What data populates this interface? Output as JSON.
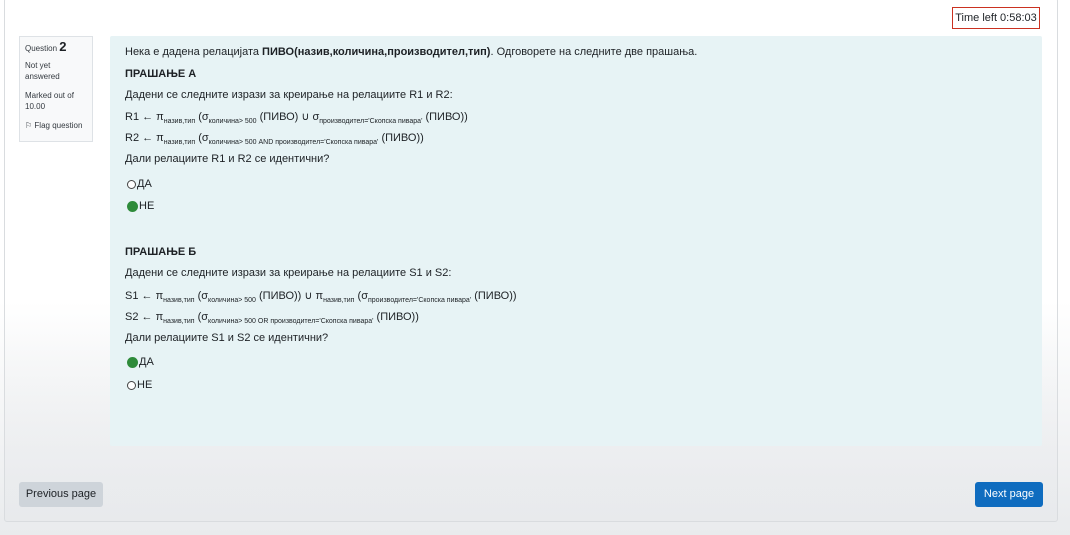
{
  "timer": {
    "text": "Time left 0:58:03"
  },
  "question_info": {
    "label": "Question",
    "number": "2",
    "state": "Not yet answered",
    "marked": "Marked out of 10.00",
    "flag_label": "Flag question"
  },
  "question": {
    "intro_prefix": "Нека е дадена релацијата ",
    "intro_bold": "ПИВО(назив,количина,производител,тип)",
    "intro_suffix": ". Одговорете на следните две прашања.",
    "part_a": {
      "heading": "ПРАШАЊЕ А",
      "prompt": "Дадени се следните изрази за креирање на релациите R1 и R2:",
      "r1": {
        "p1": "R1 ← π",
        "s1": "назив,тип",
        "p2": " (σ",
        "s2": "количина> 500",
        "p3": " (ПИВО) ∪ σ",
        "s3": "производител='Скопска пивара'",
        "p4": " (ПИВО))"
      },
      "r2": {
        "p1": "R2 ← π",
        "s1": "назив,тип",
        "p2": " (σ",
        "s2": "количина> 500 AND производител='Скопска пивара'",
        "p3": " (ПИВО))"
      },
      "question": "Дали релациите R1 и R2 се идентични?",
      "options": [
        {
          "label": "ДА",
          "checked": false
        },
        {
          "label": "НЕ",
          "checked": true
        }
      ]
    },
    "part_b": {
      "heading": "ПРАШАЊЕ Б",
      "prompt": "Дадени се следните изрази за креирање на релациите S1 и S2:",
      "s1": {
        "p1": "S1 ← π",
        "s1": "назив,тип",
        "p2": " (σ",
        "s2": "количина> 500",
        "p3": " (ПИВО)) ∪ π",
        "s3": "назив,тип",
        "p4": " (σ",
        "s4": "производител='Скопска пивара'",
        "p5": " (ПИВО))"
      },
      "s2": {
        "p1": "S2 ← π",
        "s1": "назив,тип",
        "p2": " (σ",
        "s2": "количина> 500 OR производител='Скопска пивара'",
        "p3": " (ПИВО))"
      },
      "question": "Дали релациите S1 и S2 се идентични?",
      "options": [
        {
          "label": "ДА",
          "checked": true
        },
        {
          "label": "НЕ",
          "checked": false
        }
      ]
    }
  },
  "nav": {
    "previous": "Previous page",
    "next": "Next page"
  },
  "colors": {
    "accent": "#0f6cbf",
    "content_bg": "#e7f3f5",
    "timer_border": "#ca3120",
    "selected_radio": "#2e8b3a"
  }
}
